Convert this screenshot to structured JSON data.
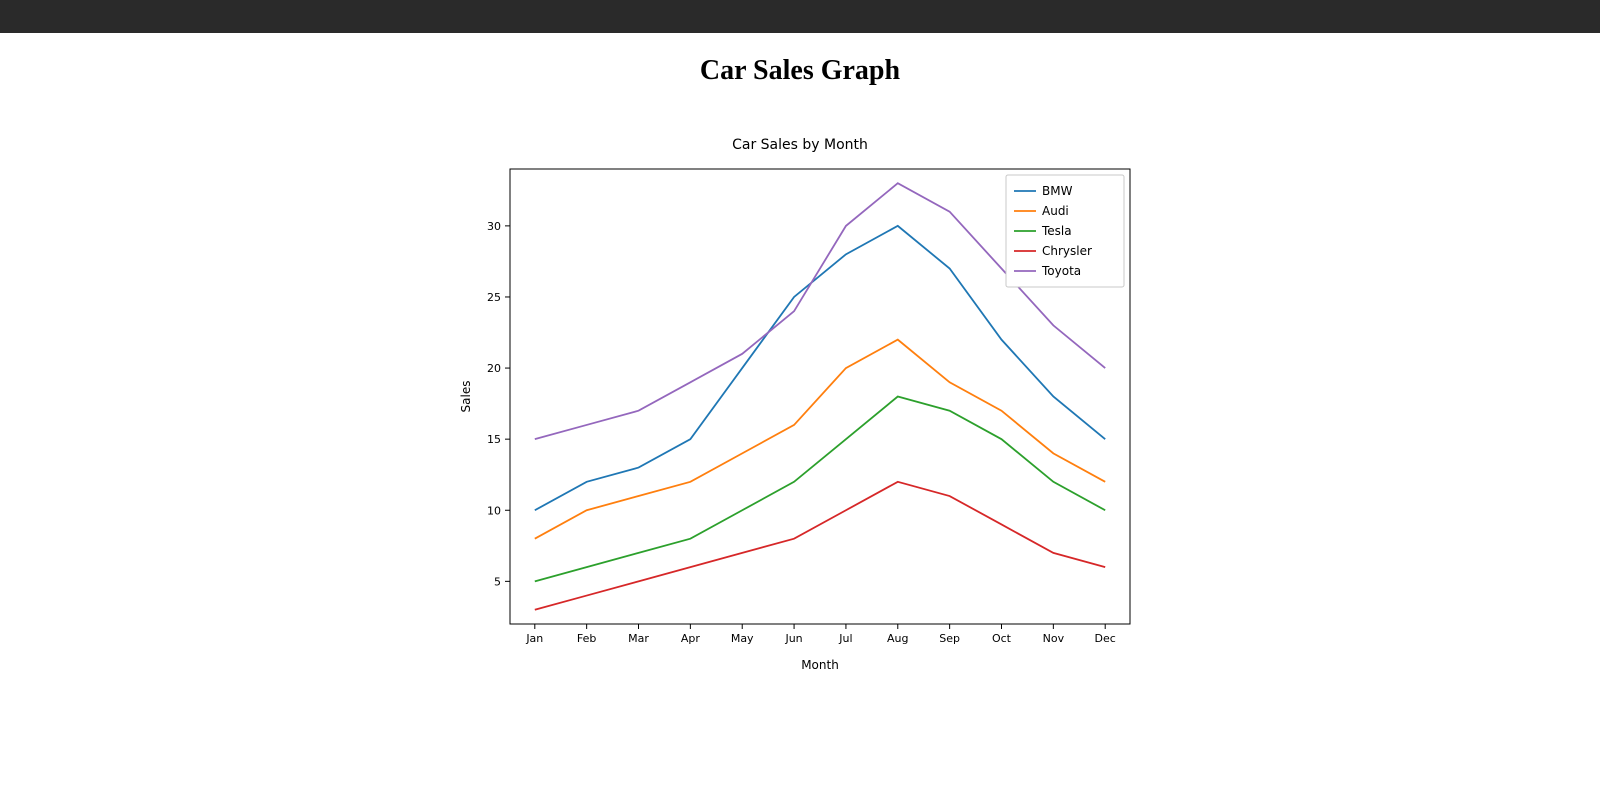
{
  "header": {
    "page_title": "Car Sales Graph"
  },
  "chart_data": {
    "type": "line",
    "title": "Car Sales by Month",
    "xlabel": "Month",
    "ylabel": "Sales",
    "categories": [
      "Jan",
      "Feb",
      "Mar",
      "Apr",
      "May",
      "Jun",
      "Jul",
      "Aug",
      "Sep",
      "Oct",
      "Nov",
      "Dec"
    ],
    "y_ticks": [
      5,
      10,
      15,
      20,
      25,
      30
    ],
    "ylim": [
      2,
      34
    ],
    "legend_position": "top-right",
    "series": [
      {
        "name": "BMW",
        "color": "#1f77b4",
        "values": [
          10,
          12,
          13,
          15,
          20,
          25,
          28,
          30,
          27,
          22,
          18,
          15
        ]
      },
      {
        "name": "Audi",
        "color": "#ff7f0e",
        "values": [
          8,
          10,
          11,
          12,
          14,
          16,
          20,
          22,
          19,
          17,
          14,
          12
        ]
      },
      {
        "name": "Tesla",
        "color": "#2ca02c",
        "values": [
          5,
          6,
          7,
          8,
          10,
          12,
          15,
          18,
          17,
          15,
          12,
          10
        ]
      },
      {
        "name": "Chrysler",
        "color": "#d62728",
        "values": [
          3,
          4,
          5,
          6,
          7,
          8,
          10,
          12,
          11,
          9,
          7,
          6
        ]
      },
      {
        "name": "Toyota",
        "color": "#9467bd",
        "values": [
          15,
          16,
          17,
          19,
          21,
          24,
          30,
          33,
          31,
          27,
          23,
          20
        ]
      }
    ]
  }
}
